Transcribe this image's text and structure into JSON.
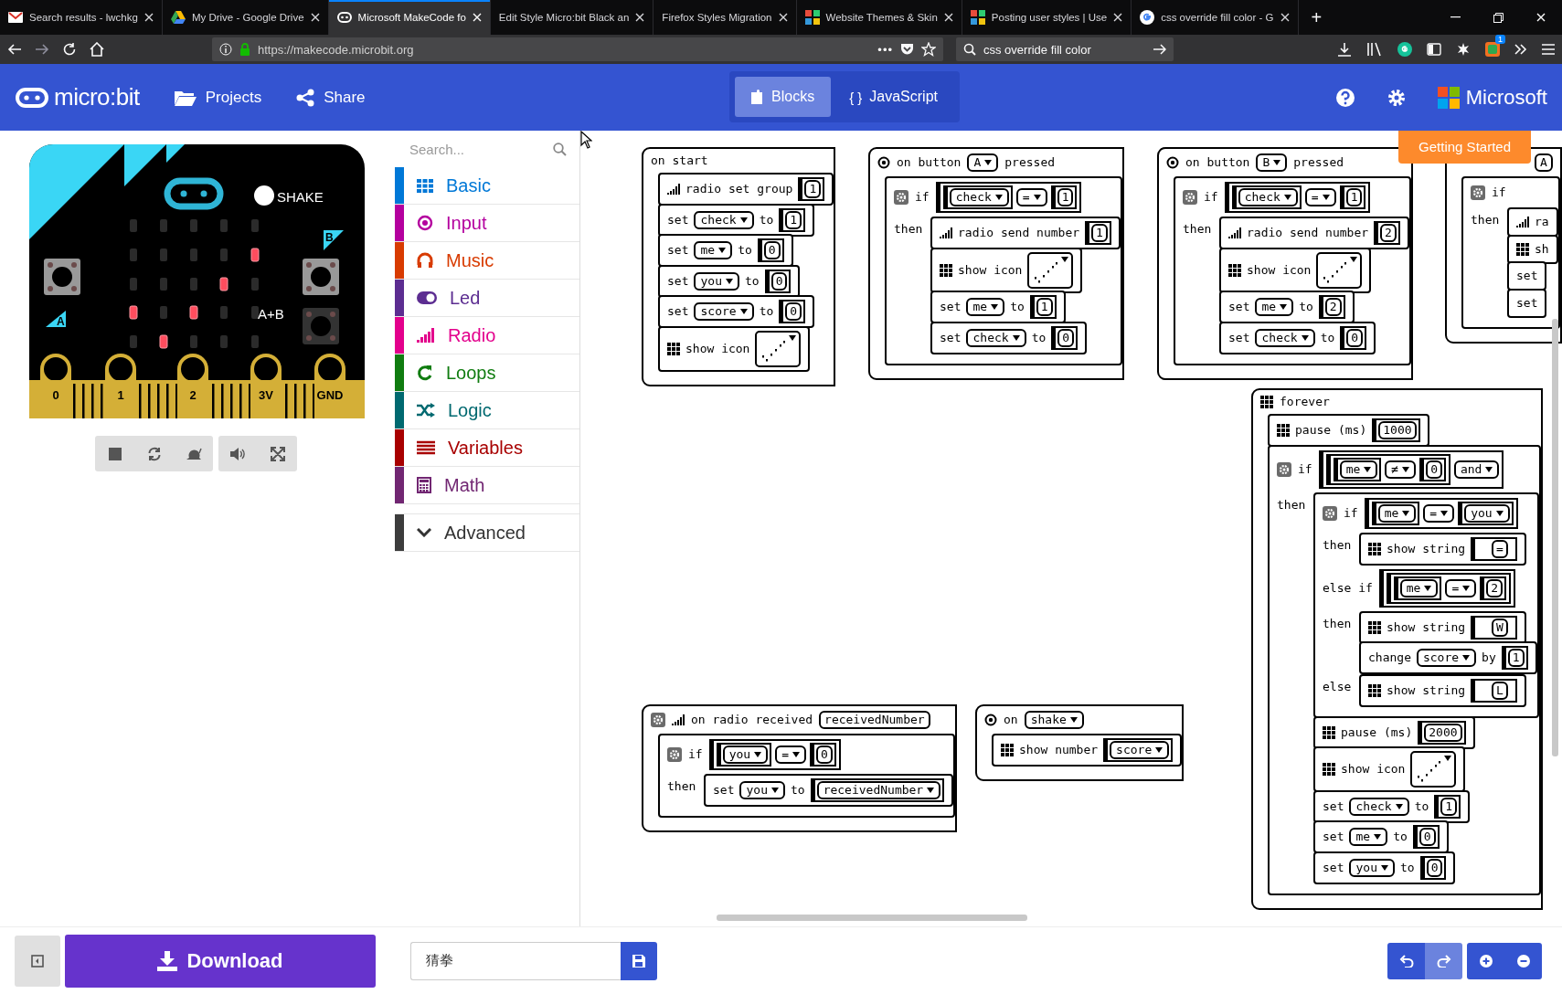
{
  "browser": {
    "tabs": [
      {
        "title": "Search results - lwchkg",
        "selected": false
      },
      {
        "title": "My Drive - Google Drive",
        "selected": false
      },
      {
        "title": "Microsoft MakeCode fo",
        "selected": true
      },
      {
        "title": "Edit Style Micro:bit Black an",
        "selected": false
      },
      {
        "title": "Firefox Styles Migration",
        "selected": false
      },
      {
        "title": "Website Themes & Skin",
        "selected": false
      },
      {
        "title": "Posting user styles | Use",
        "selected": false
      },
      {
        "title": "css override fill color - G",
        "selected": false
      }
    ],
    "new_tab": "+",
    "url": "https://makecode.microbit.org",
    "page_actions": "•••",
    "search": {
      "value": "css override fill color"
    },
    "extension_badge": "1"
  },
  "header": {
    "logo": "micro:bit",
    "nav": [
      {
        "label": "Projects"
      },
      {
        "label": "Share"
      }
    ],
    "editor_toggle": [
      {
        "label": "Blocks",
        "selected": true
      },
      {
        "label": "JavaScript",
        "glyph": "{ }",
        "selected": false
      }
    ],
    "brand": "Microsoft"
  },
  "simulator": {
    "shake_label": "SHAKE",
    "button_labels": [
      "A",
      "B",
      "A+B"
    ],
    "pins": [
      "0",
      "1",
      "2",
      "3V",
      "GND"
    ],
    "led_rows": [
      [
        false,
        false,
        false,
        false,
        false
      ],
      [
        false,
        false,
        false,
        false,
        true
      ],
      [
        false,
        false,
        false,
        true,
        false
      ],
      [
        true,
        false,
        true,
        false,
        false
      ],
      [
        false,
        true,
        false,
        false,
        false
      ]
    ]
  },
  "toolbox": {
    "search": {
      "placeholder": "Search..."
    },
    "categories": [
      {
        "label": "Basic",
        "color": "#0078d7"
      },
      {
        "label": "Input",
        "color": "#b4009e"
      },
      {
        "label": "Music",
        "color": "#d83b01"
      },
      {
        "label": "Led",
        "color": "#5c2d91"
      },
      {
        "label": "Radio",
        "color": "#e3008c"
      },
      {
        "label": "Loops",
        "color": "#107c10"
      },
      {
        "label": "Logic",
        "color": "#006970"
      },
      {
        "label": "Variables",
        "color": "#a80000"
      },
      {
        "label": "Math",
        "color": "#712672"
      }
    ],
    "advanced": {
      "label": "Advanced",
      "expanded": false
    }
  },
  "workspace": {
    "getting_started": "Getting Started",
    "stacks": [
      {
        "kind": "event",
        "parts": [
          {
            "kind": "label",
            "text": "on start"
          }
        ],
        "body": [
          {
            "kind": "statement",
            "parts": [
              {
                "kind": "radio_icon"
              },
              {
                "kind": "label",
                "text": "radio set group"
              },
              {
                "kind": "number",
                "text": "1"
              }
            ]
          },
          {
            "kind": "statement",
            "parts": [
              {
                "kind": "label",
                "text": "set"
              },
              {
                "kind": "dropdown",
                "text": "check"
              },
              {
                "kind": "label",
                "text": "to"
              },
              {
                "kind": "number",
                "text": "1"
              }
            ]
          },
          {
            "kind": "statement",
            "parts": [
              {
                "kind": "label",
                "text": "set"
              },
              {
                "kind": "dropdown",
                "text": "me"
              },
              {
                "kind": "label",
                "text": "to"
              },
              {
                "kind": "number",
                "text": "0"
              }
            ]
          },
          {
            "kind": "statement",
            "parts": [
              {
                "kind": "label",
                "text": "set"
              },
              {
                "kind": "dropdown",
                "text": "you"
              },
              {
                "kind": "label",
                "text": "to"
              },
              {
                "kind": "number",
                "text": "0"
              }
            ]
          },
          {
            "kind": "statement",
            "parts": [
              {
                "kind": "label",
                "text": "set"
              },
              {
                "kind": "dropdown",
                "text": "score"
              },
              {
                "kind": "label",
                "text": "to"
              },
              {
                "kind": "number",
                "text": "0"
              }
            ]
          },
          {
            "kind": "statement",
            "parts": [
              {
                "kind": "grid_icon"
              },
              {
                "kind": "label",
                "text": "show icon"
              },
              {
                "kind": "led_picker"
              }
            ]
          }
        ]
      },
      {
        "kind": "event",
        "parts": [
          {
            "kind": "target_icon"
          },
          {
            "kind": "label",
            "text": "on button"
          },
          {
            "kind": "dropdown",
            "text": "A"
          },
          {
            "kind": "label",
            "text": "pressed"
          }
        ],
        "body": [
          {
            "kind": "if",
            "rows": [
              {
                "label": "if",
                "condition": [
                  {
                    "kind": "compare",
                    "items": [
                      {
                        "kind": "variable",
                        "text": "check"
                      },
                      {
                        "kind": "dropdown",
                        "text": "="
                      },
                      {
                        "kind": "number",
                        "text": "1"
                      }
                    ]
                  }
                ]
              },
              {
                "label": "then",
                "body": [
                  {
                    "kind": "statement",
                    "parts": [
                      {
                        "kind": "radio_icon"
                      },
                      {
                        "kind": "label",
                        "text": "radio send number"
                      },
                      {
                        "kind": "number",
                        "text": "1"
                      }
                    ]
                  },
                  {
                    "kind": "statement",
                    "parts": [
                      {
                        "kind": "grid_icon"
                      },
                      {
                        "kind": "label",
                        "text": "show icon"
                      },
                      {
                        "kind": "led_picker"
                      }
                    ]
                  },
                  {
                    "kind": "statement",
                    "parts": [
                      {
                        "kind": "label",
                        "text": "set"
                      },
                      {
                        "kind": "dropdown",
                        "text": "me"
                      },
                      {
                        "kind": "label",
                        "text": "to"
                      },
                      {
                        "kind": "number",
                        "text": "1"
                      }
                    ]
                  },
                  {
                    "kind": "statement",
                    "parts": [
                      {
                        "kind": "label",
                        "text": "set"
                      },
                      {
                        "kind": "dropdown",
                        "text": "check"
                      },
                      {
                        "kind": "label",
                        "text": "to"
                      },
                      {
                        "kind": "number",
                        "text": "0"
                      }
                    ]
                  }
                ]
              }
            ]
          }
        ]
      },
      {
        "kind": "event",
        "parts": [
          {
            "kind": "target_icon"
          },
          {
            "kind": "label",
            "text": "on button"
          },
          {
            "kind": "dropdown",
            "text": "B"
          },
          {
            "kind": "label",
            "text": "pressed"
          }
        ],
        "body": [
          {
            "kind": "if",
            "rows": [
              {
                "label": "if",
                "condition": [
                  {
                    "kind": "compare",
                    "items": [
                      {
                        "kind": "variable",
                        "text": "check"
                      },
                      {
                        "kind": "dropdown",
                        "text": "="
                      },
                      {
                        "kind": "number",
                        "text": "1"
                      }
                    ]
                  }
                ]
              },
              {
                "label": "then",
                "body": [
                  {
                    "kind": "statement",
                    "parts": [
                      {
                        "kind": "radio_icon"
                      },
                      {
                        "kind": "label",
                        "text": "radio send number"
                      },
                      {
                        "kind": "number",
                        "text": "2"
                      }
                    ]
                  },
                  {
                    "kind": "statement",
                    "parts": [
                      {
                        "kind": "grid_icon"
                      },
                      {
                        "kind": "label",
                        "text": "show icon"
                      },
                      {
                        "kind": "led_picker"
                      }
                    ]
                  },
                  {
                    "kind": "statement",
                    "parts": [
                      {
                        "kind": "label",
                        "text": "set"
                      },
                      {
                        "kind": "dropdown",
                        "text": "me"
                      },
                      {
                        "kind": "label",
                        "text": "to"
                      },
                      {
                        "kind": "number",
                        "text": "2"
                      }
                    ]
                  },
                  {
                    "kind": "statement",
                    "parts": [
                      {
                        "kind": "label",
                        "text": "set"
                      },
                      {
                        "kind": "dropdown",
                        "text": "check"
                      },
                      {
                        "kind": "label",
                        "text": "to"
                      },
                      {
                        "kind": "number",
                        "text": "0"
                      }
                    ]
                  }
                ]
              }
            ]
          }
        ]
      },
      {
        "kind": "event",
        "parts": [
          {
            "kind": "pill",
            "text": "A"
          }
        ],
        "body": [
          {
            "kind": "if",
            "rows": [
              {
                "label": "if"
              },
              {
                "label": "then",
                "body": [
                  {
                    "kind": "statement",
                    "parts": [
                      {
                        "kind": "radio_icon"
                      },
                      {
                        "kind": "label",
                        "text": "ra"
                      }
                    ]
                  },
                  {
                    "kind": "statement",
                    "parts": [
                      {
                        "kind": "grid_icon"
                      },
                      {
                        "kind": "label",
                        "text": "sh"
                      }
                    ]
                  },
                  {
                    "kind": "statement",
                    "parts": [
                      {
                        "kind": "label",
                        "text": "set"
                      }
                    ]
                  },
                  {
                    "kind": "statement",
                    "parts": [
                      {
                        "kind": "label",
                        "text": "set"
                      }
                    ]
                  }
                ]
              }
            ]
          }
        ]
      },
      {
        "kind": "event",
        "parts": [
          {
            "kind": "grid_icon"
          },
          {
            "kind": "label",
            "text": "forever"
          }
        ],
        "body": [
          {
            "kind": "statement",
            "parts": [
              {
                "kind": "grid_icon"
              },
              {
                "kind": "label",
                "text": "pause (ms)"
              },
              {
                "kind": "number",
                "text": "1000"
              }
            ]
          },
          {
            "kind": "if",
            "rows": [
              {
                "label": "if",
                "condition": [
                  {
                    "kind": "compare",
                    "items": [
                      {
                        "kind": "compare",
                        "items": [
                          {
                            "kind": "variable",
                            "text": "me"
                          },
                          {
                            "kind": "dropdown",
                            "text": "≠"
                          },
                          {
                            "kind": "number",
                            "text": "0"
                          }
                        ]
                      },
                      {
                        "kind": "dropdown",
                        "text": "and"
                      }
                    ]
                  }
                ]
              },
              {
                "label": "then",
                "body": [
                  {
                    "kind": "if",
                    "rows": [
                      {
                        "label": "if",
                        "condition": [
                          {
                            "kind": "compare",
                            "items": [
                              {
                                "kind": "variable",
                                "text": "me"
                              },
                              {
                                "kind": "dropdown",
                                "text": "="
                              },
                              {
                                "kind": "variable",
                                "text": "you"
                              }
                            ]
                          }
                        ]
                      },
                      {
                        "label": "then",
                        "body": [
                          {
                            "kind": "statement",
                            "parts": [
                              {
                                "kind": "grid_icon"
                              },
                              {
                                "kind": "label",
                                "text": "show string"
                              },
                              {
                                "kind": "string",
                                "text": "="
                              }
                            ]
                          }
                        ]
                      },
                      {
                        "label": "else if",
                        "condition": [
                          {
                            "kind": "compare",
                            "items": [
                              {
                                "kind": "compare",
                                "items": [
                                  {
                                    "kind": "variable",
                                    "text": "me"
                                  },
                                  {
                                    "kind": "dropdown",
                                    "text": "="
                                  },
                                  {
                                    "kind": "number",
                                    "text": "2"
                                  }
                                ]
                              }
                            ]
                          }
                        ]
                      },
                      {
                        "label": "then",
                        "body": [
                          {
                            "kind": "statement",
                            "parts": [
                              {
                                "kind": "grid_icon"
                              },
                              {
                                "kind": "label",
                                "text": "show string"
                              },
                              {
                                "kind": "string",
                                "text": "W"
                              }
                            ]
                          },
                          {
                            "kind": "statement",
                            "parts": [
                              {
                                "kind": "label",
                                "text": "change"
                              },
                              {
                                "kind": "dropdown",
                                "text": "score"
                              },
                              {
                                "kind": "label",
                                "text": "by"
                              },
                              {
                                "kind": "number",
                                "text": "1"
                              }
                            ]
                          }
                        ]
                      },
                      {
                        "label": "else",
                        "body": [
                          {
                            "kind": "statement",
                            "parts": [
                              {
                                "kind": "grid_icon"
                              },
                              {
                                "kind": "label",
                                "text": "show string"
                              },
                              {
                                "kind": "string",
                                "text": "L"
                              }
                            ]
                          }
                        ]
                      }
                    ]
                  },
                  {
                    "kind": "statement",
                    "parts": [
                      {
                        "kind": "grid_icon"
                      },
                      {
                        "kind": "label",
                        "text": "pause (ms)"
                      },
                      {
                        "kind": "number",
                        "text": "2000"
                      }
                    ]
                  },
                  {
                    "kind": "statement",
                    "parts": [
                      {
                        "kind": "grid_icon"
                      },
                      {
                        "kind": "label",
                        "text": "show icon"
                      },
                      {
                        "kind": "led_picker"
                      }
                    ]
                  },
                  {
                    "kind": "statement",
                    "parts": [
                      {
                        "kind": "label",
                        "text": "set"
                      },
                      {
                        "kind": "dropdown",
                        "text": "check"
                      },
                      {
                        "kind": "label",
                        "text": "to"
                      },
                      {
                        "kind": "number",
                        "text": "1"
                      }
                    ]
                  },
                  {
                    "kind": "statement",
                    "parts": [
                      {
                        "kind": "label",
                        "text": "set"
                      },
                      {
                        "kind": "dropdown",
                        "text": "me"
                      },
                      {
                        "kind": "label",
                        "text": "to"
                      },
                      {
                        "kind": "number",
                        "text": "0"
                      }
                    ]
                  },
                  {
                    "kind": "statement",
                    "parts": [
                      {
                        "kind": "label",
                        "text": "set"
                      },
                      {
                        "kind": "dropdown",
                        "text": "you"
                      },
                      {
                        "kind": "label",
                        "text": "to"
                      },
                      {
                        "kind": "number",
                        "text": "0"
                      }
                    ]
                  }
                ]
              }
            ]
          }
        ]
      },
      {
        "kind": "event",
        "parts": [
          {
            "kind": "gear"
          },
          {
            "kind": "radio_icon"
          },
          {
            "kind": "label",
            "text": "on radio received"
          },
          {
            "kind": "pill",
            "text": "receivedNumber"
          }
        ],
        "body": [
          {
            "kind": "if",
            "rows": [
              {
                "label": "if",
                "condition": [
                  {
                    "kind": "compare",
                    "items": [
                      {
                        "kind": "variable",
                        "text": "you"
                      },
                      {
                        "kind": "dropdown",
                        "text": "="
                      },
                      {
                        "kind": "number",
                        "text": "0"
                      }
                    ]
                  }
                ]
              },
              {
                "label": "then",
                "body": [
                  {
                    "kind": "statement",
                    "parts": [
                      {
                        "kind": "label",
                        "text": "set"
                      },
                      {
                        "kind": "dropdown",
                        "text": "you"
                      },
                      {
                        "kind": "label",
                        "text": "to"
                      },
                      {
                        "kind": "variable",
                        "text": "receivedNumber"
                      }
                    ]
                  }
                ]
              }
            ]
          }
        ]
      },
      {
        "kind": "event",
        "parts": [
          {
            "kind": "target_icon"
          },
          {
            "kind": "label",
            "text": "on"
          },
          {
            "kind": "dropdown",
            "text": "shake"
          }
        ],
        "body": [
          {
            "kind": "statement",
            "parts": [
              {
                "kind": "grid_icon"
              },
              {
                "kind": "label",
                "text": "show number"
              },
              {
                "kind": "variable",
                "text": "score"
              }
            ]
          }
        ]
      }
    ]
  },
  "bottom_bar": {
    "download": "Download",
    "project_name": {
      "value": "猜拳"
    }
  }
}
